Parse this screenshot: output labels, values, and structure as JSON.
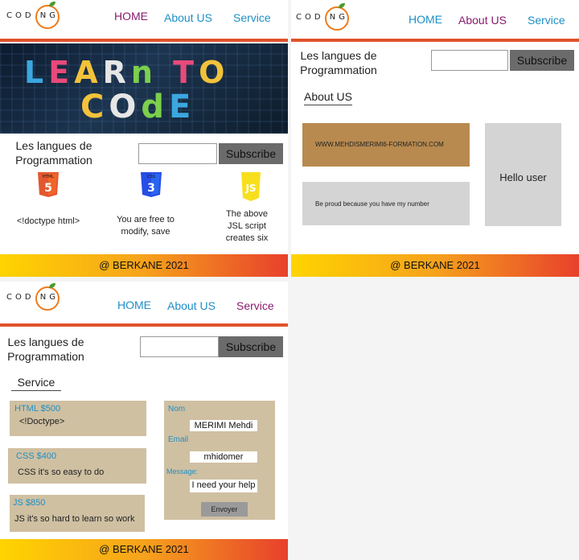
{
  "brand": {
    "logo_text": "COD NG"
  },
  "nav": {
    "home": "HOME",
    "about": "About US",
    "service": "Service"
  },
  "common": {
    "langs_line1": "Les langues de",
    "langs_line2": "Programmation",
    "subscribe": "Subscribe",
    "footer": "@ BERKANE 2021"
  },
  "hero": {
    "line1": "LEARn TO",
    "line2": "COdE"
  },
  "home": {
    "items": [
      {
        "icon": "html5-icon",
        "badge": "HTML",
        "glyph": "5",
        "caption": "<!doctype html>"
      },
      {
        "icon": "css3-icon",
        "badge": "CSS",
        "glyph": "3",
        "caption_l1": "You are free to",
        "caption_l2": "modify, save"
      },
      {
        "icon": "js-icon",
        "badge": "",
        "glyph": "JS",
        "caption_l1": "The above",
        "caption_l2": "JSL script",
        "caption_l3": "creates six"
      }
    ]
  },
  "about": {
    "title": "About US",
    "card1": "WWW.MEHDISMERIMI6-FORMATION.COM",
    "card2": "Be proud because you have my number",
    "card3": "Hello user"
  },
  "service": {
    "title": "Service",
    "cards": [
      {
        "title": "HTML $500",
        "desc": "<!Doctype>"
      },
      {
        "title": "CSS $400",
        "desc": "CSS it's so easy to do"
      },
      {
        "title": "JS $850",
        "desc": "JS it's so hard to learn so work"
      }
    ],
    "form": {
      "nom_label": "Nom",
      "nom_value": "MERIMI Mehdi",
      "email_label": "Email",
      "email_value": "mhidomer",
      "message_label": "Message:",
      "message_value": "I need your help",
      "send": "Envoyer"
    }
  },
  "colors": {
    "nav_link": "#1e8fc6",
    "nav_active": "#8a1a6e",
    "accent_bar": "#e0532a",
    "card_bg": "#cfc0a2",
    "about_brown": "#b88a4f",
    "about_grey": "#d4d4d4"
  }
}
